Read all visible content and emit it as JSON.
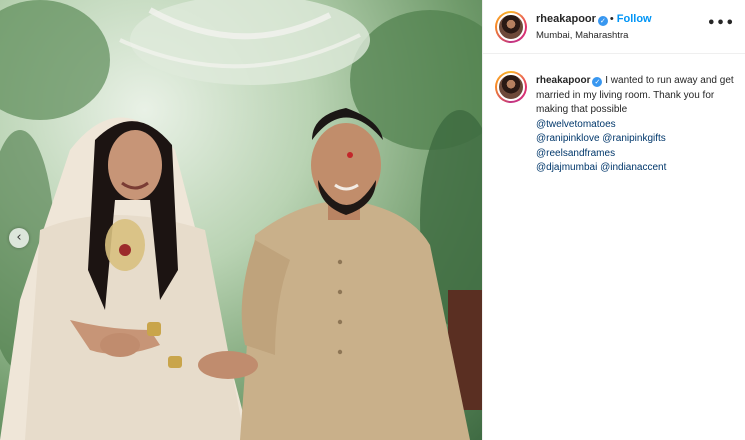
{
  "post": {
    "username": "rheakapoor",
    "verified_icon": "verified-badge-icon",
    "follow_label": "Follow",
    "separator": "•",
    "location": "Mumbai, Maharashtra",
    "more_label": "•••"
  },
  "caption": {
    "username": "rheakapoor",
    "text": "I wanted to run away and get married in my living room. Thank you for making that possible",
    "mentions": [
      "@twelvetomatoes",
      "@ranipinklove",
      "@ranipinkgifts",
      "@reelsandframes",
      "@djajmumbai",
      "@indianaccent"
    ]
  },
  "photo": {
    "prev_label": "‹"
  },
  "colors": {
    "link_blue": "#0095f6",
    "mention_blue": "#00376b",
    "verified_blue": "#3897f0"
  }
}
